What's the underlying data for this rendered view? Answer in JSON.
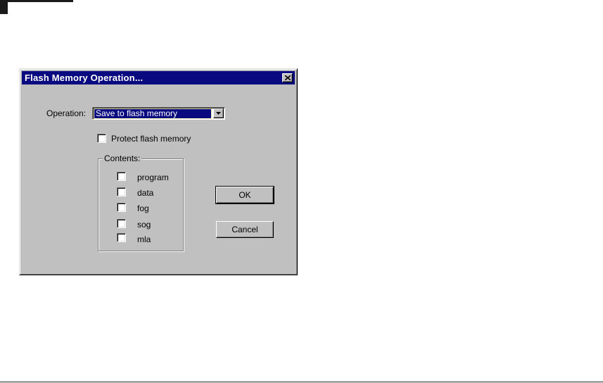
{
  "dialog": {
    "title": "Flash Memory Operation...",
    "operation_label": "Operation:",
    "operation_value": "Save to flash memory",
    "protect_label": "Protect flash memory",
    "contents_label": "Contents:",
    "contents_items": [
      {
        "label": "program",
        "checked": false
      },
      {
        "label": "data",
        "checked": false
      },
      {
        "label": "fog",
        "checked": false
      },
      {
        "label": "sog",
        "checked": false
      },
      {
        "label": "mla",
        "checked": false
      }
    ],
    "ok_label": "OK",
    "cancel_label": "Cancel"
  },
  "icons": {
    "close": "close-icon",
    "dropdown": "chevron-down-icon"
  },
  "colors": {
    "titlebar": "#0a0a80",
    "dialog_face": "#c0c0c0",
    "selection": "#0a0a80"
  }
}
